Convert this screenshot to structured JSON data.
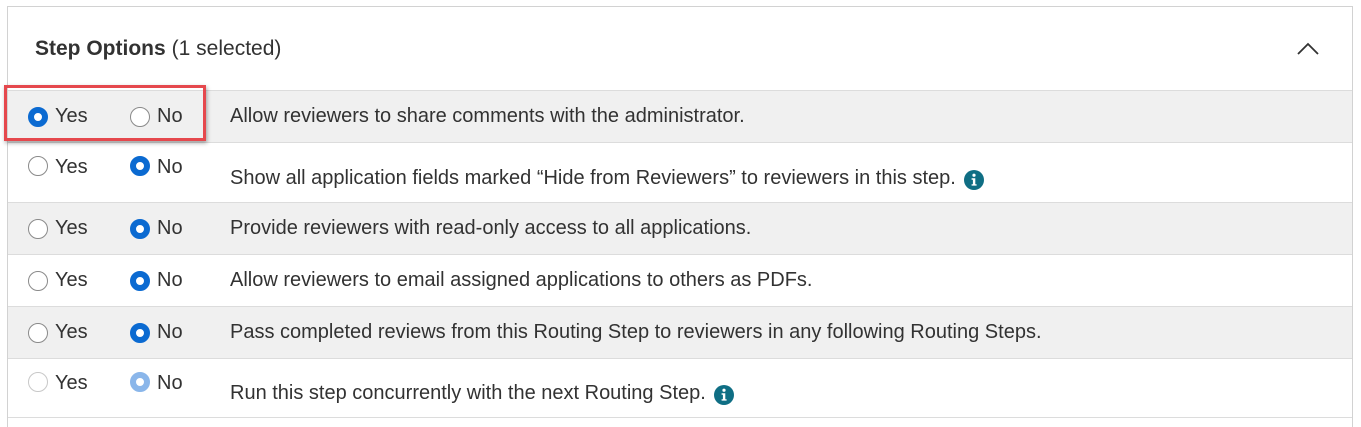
{
  "header": {
    "title": "Step Options",
    "selected_count": "(1 selected)",
    "collapse_icon": "chevron-up-icon"
  },
  "options": {
    "yes_label": "Yes",
    "no_label": "No"
  },
  "rows": [
    {
      "text": "Allow reviewers to share comments with the administrator.",
      "selected": "yes",
      "info": false,
      "disabled": false
    },
    {
      "text": "Show all application fields marked “Hide from Reviewers” to reviewers in this step.",
      "selected": "no",
      "info": true,
      "disabled": false
    },
    {
      "text": "Provide reviewers with read-only access to all applications.",
      "selected": "no",
      "info": false,
      "disabled": false
    },
    {
      "text": "Allow reviewers to email assigned applications to others as PDFs.",
      "selected": "no",
      "info": false,
      "disabled": false
    },
    {
      "text": "Pass completed reviews from this Routing Step to reviewers in any following Routing Steps.",
      "selected": "no",
      "info": false,
      "disabled": false
    },
    {
      "text": "Run this step concurrently with the next Routing Step.",
      "selected": "no",
      "info": true,
      "disabled": true
    }
  ],
  "colors": {
    "accent": "#0b6ad1",
    "info": "#0f6e84",
    "highlight": "#e5484d",
    "row_shade": "#f0f0f0"
  }
}
